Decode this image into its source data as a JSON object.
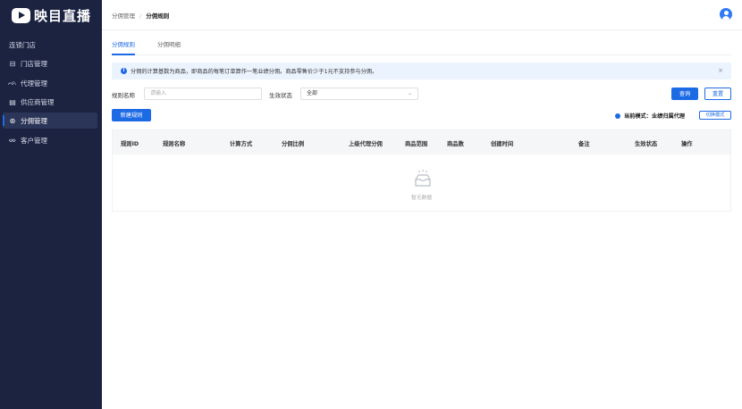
{
  "brand": {
    "name": "映目直播"
  },
  "sidebar": {
    "items": [
      {
        "label": "连锁门店",
        "icon": ""
      },
      {
        "label": "门店管理",
        "icon": "store-icon"
      },
      {
        "label": "代理管理",
        "icon": "agent-icon"
      },
      {
        "label": "供应商管理",
        "icon": "supplier-icon"
      },
      {
        "label": "分佣管理",
        "icon": "commission-icon"
      },
      {
        "label": "客户管理",
        "icon": "customer-icon"
      }
    ],
    "active_index": 4
  },
  "breadcrumb": {
    "parent": "分佣管理",
    "separator": "/",
    "current": "分佣规则"
  },
  "tabs": [
    {
      "label": "分佣规则"
    },
    {
      "label": "分佣明细"
    }
  ],
  "alert": {
    "message": "分佣的计算基数为商品，即商品的每笔订单算作一笔业绩分佣。商品零售价少于1元不支持参与分佣。",
    "close": "×"
  },
  "filters": {
    "name_label": "规则名称",
    "name_placeholder": "请输入",
    "status_label": "生效状态",
    "status_value": "全部"
  },
  "actions": {
    "search": "查询",
    "reset": "重置",
    "new_rule": "新建规则",
    "switch_mode": "切换模式"
  },
  "mode": {
    "text": "当前模式：业绩归属代理"
  },
  "table": {
    "columns": [
      "规则ID",
      "规则名称",
      "计算方式",
      "分佣比例",
      "上级代理分佣",
      "商品范围",
      "商品数",
      "创建时间",
      "备注",
      "生效状态",
      "操作"
    ],
    "rows": [],
    "empty_text": "暂无数据"
  },
  "colors": {
    "primary": "#1d6ae5",
    "sidebar_bg": "#1b2341",
    "alert_bg": "#eaf3fe"
  }
}
